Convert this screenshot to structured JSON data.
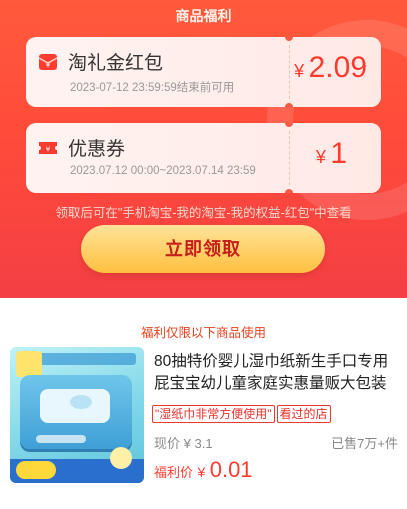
{
  "header": {
    "title": "商品福利"
  },
  "coupons": [
    {
      "icon": "red-envelope-icon",
      "name": "淘礼金红包",
      "sub": "2023-07-12 23:59:59结束前可用",
      "currency": "¥",
      "amount": "2.09"
    },
    {
      "icon": "coupon-ticket-icon",
      "name": "优惠券",
      "sub": "2023.07.12 00:00~2023.07.14 23:59",
      "currency": "¥",
      "amount": "1"
    }
  ],
  "note": "领取后可在\"手机淘宝-我的淘宝-我的权益-红包\"中查看",
  "claim_button": "立即领取",
  "scope_text": "福利仅限以下商品使用",
  "product": {
    "title": "80抽特价婴儿湿巾纸新生手口专用屁宝宝幼儿童家庭实惠量贩大包装",
    "tags": [
      "\"湿纸巾非常方便使用\"",
      "看过的店"
    ],
    "current_price_label": "现价",
    "current_price": "¥ 3.1",
    "sold": "已售7万+件",
    "welfare_label": "福利价",
    "welfare_currency": "¥",
    "welfare_price": "0.01"
  },
  "colors": {
    "accent": "#ff3b2f",
    "hero": "#ff4b3a",
    "button": "#ffc03f"
  }
}
